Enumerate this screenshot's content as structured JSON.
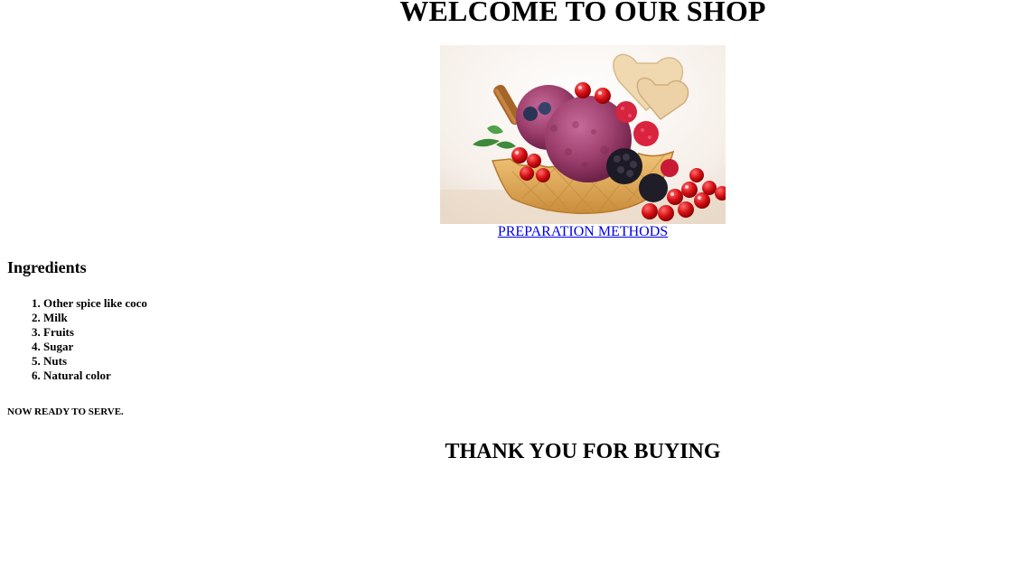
{
  "header": {
    "title": "WELCOME TO OUR SHOP"
  },
  "hero": {
    "image_subject": "ice cream in waffle bowl with berries"
  },
  "links": {
    "preparation": "PREPARATION METHODS"
  },
  "ingredients": {
    "heading": "Ingredients",
    "items": [
      "Other spice like coco",
      "Milk",
      "Fruits",
      "Sugar",
      "Nuts",
      "Natural color"
    ]
  },
  "footer": {
    "ready_text": "NOW READY TO SERVE.",
    "thanks": "THANK YOU FOR BUYING"
  },
  "colors": {
    "link": "#0000ee",
    "text": "#000000",
    "background": "#ffffff"
  }
}
